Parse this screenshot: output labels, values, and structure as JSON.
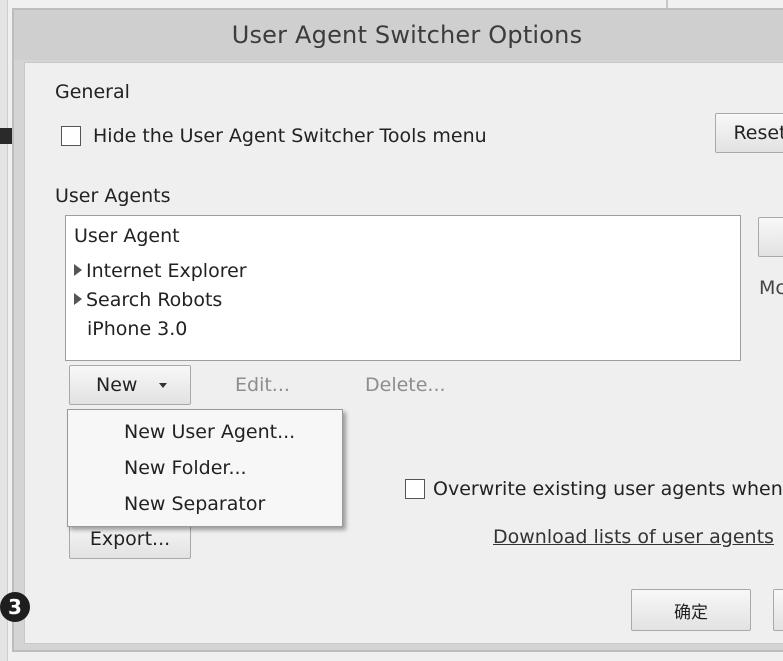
{
  "window": {
    "title": "User Agent Switcher Options"
  },
  "general": {
    "heading": "General",
    "hide_menu_label": "Hide the User Agent Switcher Tools menu",
    "reset_label": "Reset"
  },
  "user_agents": {
    "heading": "User Agents",
    "list_header": "User Agent",
    "items": [
      {
        "label": "Internet Explorer",
        "type": "folder"
      },
      {
        "label": "Search Robots",
        "type": "folder"
      },
      {
        "label": "iPhone 3.0",
        "type": "item"
      }
    ],
    "side_buttons": [
      "M",
      "Mc"
    ],
    "new_label": "New",
    "edit_label": "Edit...",
    "delete_label": "Delete..."
  },
  "new_menu": {
    "items": [
      "New User Agent...",
      "New Folder...",
      "New Separator"
    ]
  },
  "import_export": {
    "export_label": "Export...",
    "overwrite_label": "Overwrite existing user agents when",
    "download_link": "Download lists of user agents"
  },
  "footer": {
    "ok_label": "确定"
  },
  "step_badge": "3"
}
